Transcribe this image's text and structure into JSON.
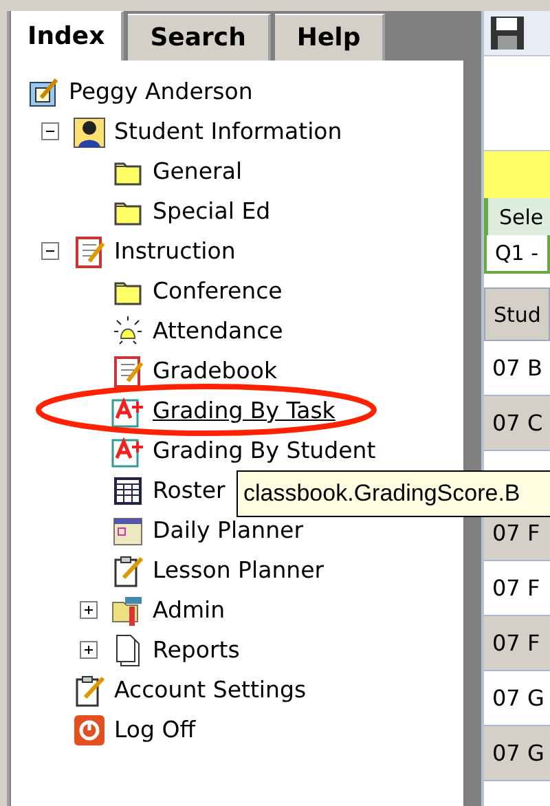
{
  "tabs": [
    {
      "label": "Index",
      "selected": true
    },
    {
      "label": "Search",
      "selected": false
    },
    {
      "label": "Help",
      "selected": false
    }
  ],
  "tree": [
    {
      "label": "Peggy Anderson",
      "kind": "notepad",
      "hovered": false,
      "children": [
        {
          "label": "Student Information",
          "kind": "person",
          "hovered": false,
          "expanded": true,
          "children": [
            {
              "label": "General",
              "kind": "folder",
              "hovered": false
            },
            {
              "label": "Special Ed",
              "kind": "folder",
              "hovered": false
            }
          ]
        },
        {
          "label": "Instruction",
          "kind": "notebook",
          "hovered": false,
          "expanded": true,
          "children": [
            {
              "label": "Conference",
              "kind": "folder",
              "hovered": false
            },
            {
              "label": "Attendance",
              "kind": "bell",
              "hovered": false
            },
            {
              "label": "Gradebook",
              "kind": "notebook",
              "hovered": false
            },
            {
              "label": "Grading By Task",
              "kind": "grade",
              "hovered": true
            },
            {
              "label": "Grading By Student",
              "kind": "grade",
              "hovered": false
            },
            {
              "label": "Roster",
              "kind": "grid",
              "hovered": false
            },
            {
              "label": "Daily Planner",
              "kind": "calendar",
              "hovered": false
            },
            {
              "label": "Lesson Planner",
              "kind": "clipboard",
              "hovered": false
            },
            {
              "label": "Admin",
              "kind": "toolbox",
              "hovered": false,
              "expanded": false
            },
            {
              "label": "Reports",
              "kind": "pages",
              "hovered": false,
              "expanded": false
            }
          ]
        },
        {
          "label": "Account Settings",
          "kind": "clipboard",
          "hovered": false
        },
        {
          "label": "Log Off",
          "kind": "power",
          "hovered": false
        }
      ]
    }
  ],
  "tooltip": {
    "text": "classbook.GradingScore.B"
  },
  "annotation": {
    "kind": "ellipse"
  },
  "right_panel": {
    "select_label": "Sele",
    "select_value": "Q1 -",
    "column_header": "Stud",
    "rows": [
      {
        "text": "07 B"
      },
      {
        "text": "07 C"
      },
      {},
      {
        "text": "07 F"
      },
      {
        "text": "07 F"
      },
      {
        "text": "07 F"
      },
      {
        "text": "07 G"
      },
      {
        "text": "07 G"
      },
      {}
    ]
  }
}
